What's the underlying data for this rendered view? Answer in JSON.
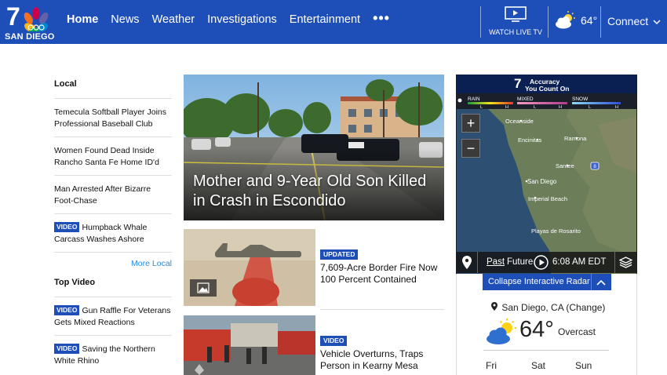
{
  "header": {
    "logo_number": "7",
    "logo_city": "SAN DIEGO",
    "nav": [
      "Home",
      "News",
      "Weather",
      "Investigations",
      "Entertainment"
    ],
    "more_label": "•••",
    "watch_live_label": "WATCH LIVE TV",
    "temperature": "64°",
    "connect_label": "Connect"
  },
  "left": {
    "local_title": "Local",
    "local_stories": [
      {
        "badge": "",
        "title": "Temecula Softball Player Joins Professional Baseball Club"
      },
      {
        "badge": "",
        "title": "Women Found Dead Inside Rancho Santa Fe Home ID'd"
      },
      {
        "badge": "",
        "title": "Man Arrested After Bizarre Foot-Chase"
      },
      {
        "badge": "VIDEO",
        "title": "Humpback Whale Carcass Washes Ashore"
      }
    ],
    "more_local": "More Local",
    "top_video_title": "Top Video",
    "video_stories": [
      {
        "badge": "VIDEO",
        "title": "Gun Raffle For Veterans Gets Mixed Reactions"
      },
      {
        "badge": "VIDEO",
        "title": "Saving the Northern White Rhino"
      }
    ]
  },
  "center": {
    "hero_title": "Mother and 9-Year Old Son Killed in Crash in Escondido",
    "cards": [
      {
        "badge": "UPDATED",
        "title": "7,609-Acre Border Fire Now 100 Percent Contained"
      },
      {
        "badge": "VIDEO",
        "title": "Vehicle Overturns, Traps Person in Kearny Mesa"
      }
    ]
  },
  "radar": {
    "brand_line1": "Accuracy",
    "brand_line2": "You Count On",
    "legend": [
      "RAIN",
      "MIXED",
      "SNOW"
    ],
    "legend_levels": [
      "L",
      "H",
      "L",
      "H",
      "L",
      "H"
    ],
    "places": [
      "Oceanside",
      "Encinitas",
      "Ramona",
      "Santee",
      "San Diego",
      "Imperial Beach",
      "Playas de Rosarito"
    ],
    "highway": "8",
    "zoom_in": "+",
    "zoom_out": "−",
    "past_label": "Past",
    "future_label": "Future",
    "time": "6:08 AM EDT",
    "collapse_label": "Collapse Interactive Radar"
  },
  "weather": {
    "location": "San Diego, CA (Change)",
    "temperature": "64°",
    "condition": "Overcast",
    "days": [
      "Fri",
      "Sat",
      "Sun"
    ]
  },
  "colors": {
    "brand_blue": "#1e4fb8",
    "link_blue": "#2b8ad8"
  }
}
